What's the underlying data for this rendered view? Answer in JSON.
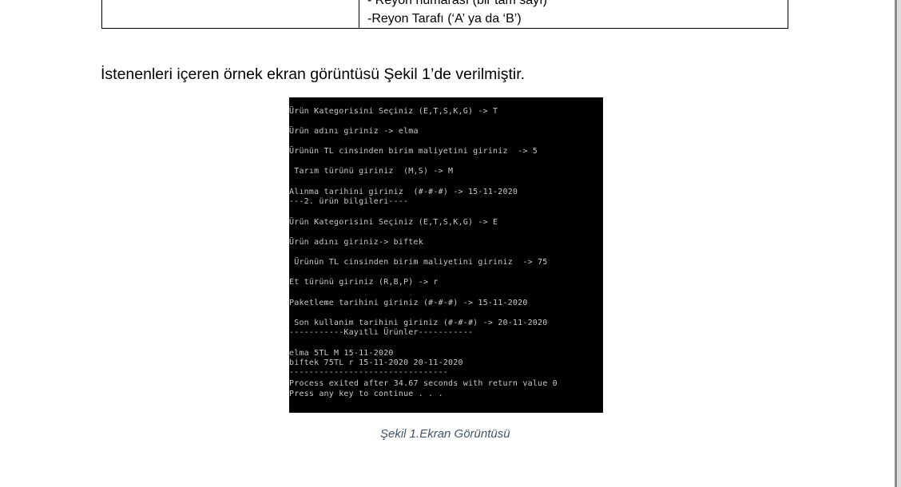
{
  "table": {
    "line1": "- Reyon numarası (bir tam sayı)",
    "line2": "-Reyon Tarafı (‘A’ ya da ‘B’)"
  },
  "paragraph": "İstenenleri içeren örnek ekran görüntüsü Şekil 1’de verilmiştir.",
  "console": {
    "lines": [
      "Ürün Kategorisini Seçiniz (E,T,S,K,G) -> T",
      "Ürün adını giriniz -> elma",
      "Ürünün TL cinsinden birim maliyetini giriniz  -> 5",
      " Tarım türünü giriniz  (M,S) -> M",
      "Alınma tarihini giriniz  (#-#-#) -> 15-11-2020",
      "---2. ürün bilgileri----",
      "Ürün Kategorisini Seçiniz (E,T,S,K,G) -> E",
      "Ürün adını giriniz-> biftek",
      " Ürünün TL cinsinden birim maliyetini giriniz  -> 75",
      "Et türünü giriniz (R,B,P) -> r",
      "Paketleme tarihini giriniz (#-#-#) -> 15-11-2020",
      " Son kullanim tarihini giriniz (#-#-#) -> 20-11-2020",
      "-----------Kayıtlı Ürünler-----------",
      "elma 5TL M 15-11-2020",
      "biftek 75TL r 15-11-2020 20-11-2020",
      "--------------------------------",
      "Process exited after 34.67 seconds with return value 0",
      "Press any key to continue . . ."
    ]
  },
  "caption": "Şekil 1.Ekran Görüntüsü"
}
